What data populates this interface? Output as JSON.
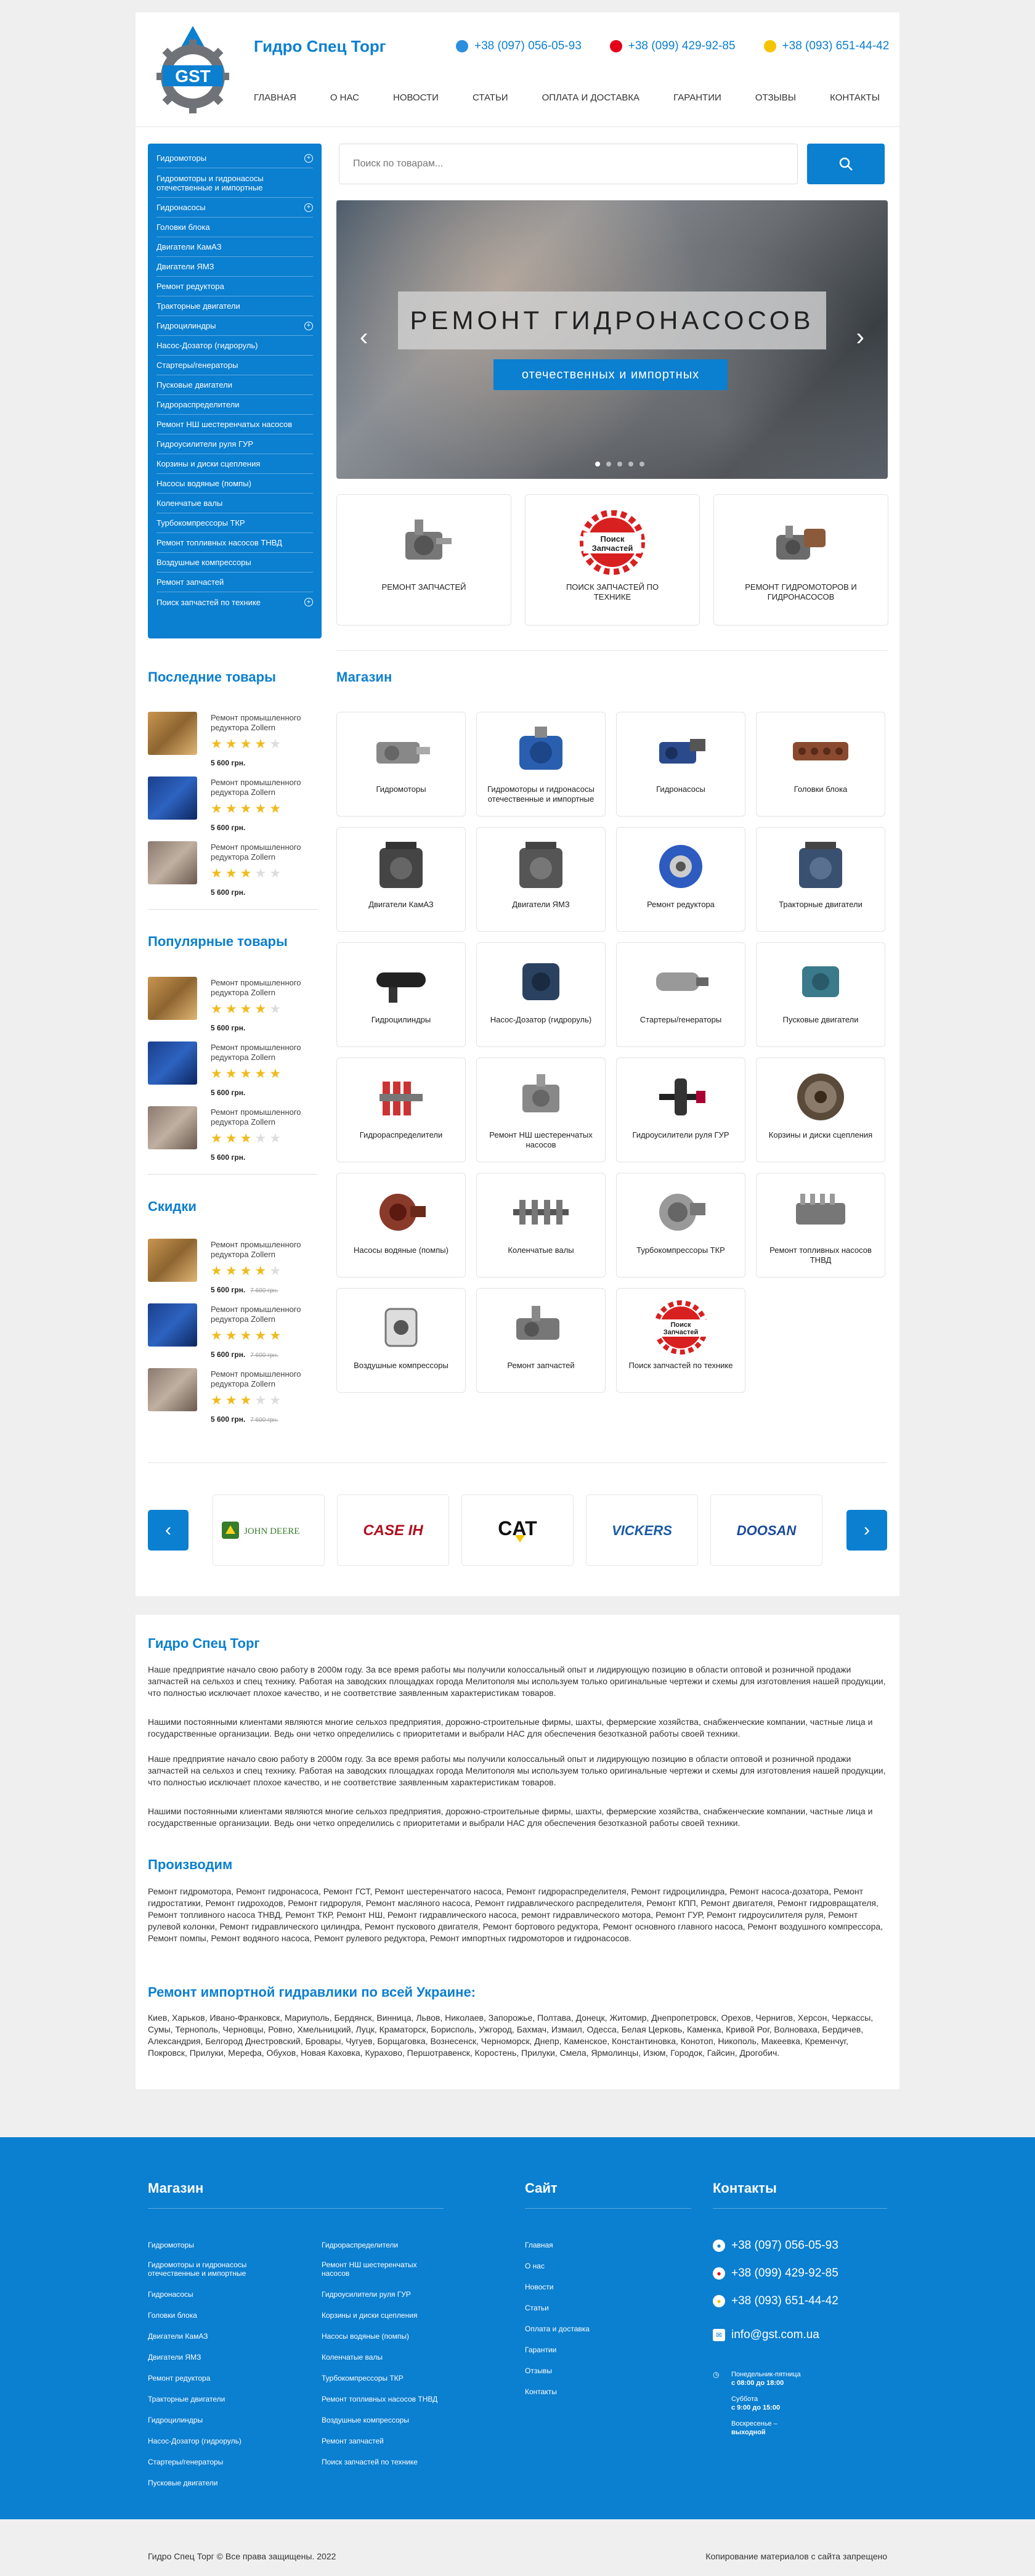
{
  "brand": {
    "name": "Гидро Спец Торг",
    "logo_text": "GST"
  },
  "phones": [
    "+38 (097) 056-05-93",
    "+38 (099) 429-92-85",
    "+38 (093) 651-44-42"
  ],
  "nav": [
    "Главная",
    "О нас",
    "Новости",
    "Статьи",
    "Оплата и доставка",
    "Гарантии",
    "Отзывы",
    "Контакты"
  ],
  "menu": [
    {
      "label": "Гидромоторы",
      "plus": true
    },
    {
      "label": "Гидромоторы и гидронасосы отечественные и импортные"
    },
    {
      "label": "Гидронасосы",
      "plus": true
    },
    {
      "label": "Головки блока"
    },
    {
      "label": "Двигатели КамАЗ"
    },
    {
      "label": "Двигатели ЯМЗ"
    },
    {
      "label": "Ремонт редуктора"
    },
    {
      "label": "Тракторные двигатели"
    },
    {
      "label": "Гидроцилиндры",
      "plus": true
    },
    {
      "label": "Насос-Дозатор (гидроруль)"
    },
    {
      "label": "Стартеры/генераторы"
    },
    {
      "label": "Пусковые двигатели"
    },
    {
      "label": "Гидрораспределители"
    },
    {
      "label": "Ремонт НШ шестеренчатых насосов"
    },
    {
      "label": "Гидроусилители руля ГУР"
    },
    {
      "label": "Корзины и диски сцепления"
    },
    {
      "label": "Насосы водяные (помпы)"
    },
    {
      "label": "Коленчатые валы"
    },
    {
      "label": "Турбокомпрессоры ТКР"
    },
    {
      "label": "Ремонт топливных насосов ТНВД"
    },
    {
      "label": "Воздушные компрессоры"
    },
    {
      "label": "Ремонт запчастей"
    },
    {
      "label": "Поиск запчастей по технике",
      "plus": true
    }
  ],
  "search": {
    "placeholder": "Поиск по товарам..."
  },
  "slider": {
    "title": "Ремонт гидронасосов",
    "subtitle": "отечественных и импортных"
  },
  "features": [
    {
      "label": "Ремонт запчастей"
    },
    {
      "label": "Поиск запчастей по технике",
      "stamp": "Поиск Запчастей"
    },
    {
      "label": "Ремонт гидромоторов и гидронасосов"
    }
  ],
  "widgets": {
    "latest": {
      "title": "Последние товары",
      "items": [
        {
          "name": "Ремонт промышленного редуктора Zollern",
          "stars": 4,
          "price": "5 600 грн."
        },
        {
          "name": "Ремонт промышленного редуктора Zollern",
          "stars": 5,
          "price": "5 600 грн."
        },
        {
          "name": "Ремонт промышленного редуктора Zollern",
          "stars": 3,
          "price": "5 600 грн."
        }
      ]
    },
    "popular": {
      "title": "Популярные товары",
      "items": [
        {
          "name": "Ремонт промышленного редуктора Zollern",
          "stars": 4,
          "price": "5 600 грн."
        },
        {
          "name": "Ремонт промышленного редуктора Zollern",
          "stars": 5,
          "price": "5 600 грн."
        },
        {
          "name": "Ремонт промышленного редуктора Zollern",
          "stars": 3,
          "price": "5 600 грн."
        }
      ]
    },
    "sale": {
      "title": "Скидки",
      "items": [
        {
          "name": "Ремонт промышленного редуктора Zollern",
          "stars": 4,
          "price": "5 600 грн.",
          "old": "7 600 грн."
        },
        {
          "name": "Ремонт промышленного редуктора Zollern",
          "stars": 5,
          "price": "5 600 грн.",
          "old": "7 600 грн."
        },
        {
          "name": "Ремонт промышленного редуктора Zollern",
          "stars": 3,
          "price": "5 600 грн.",
          "old": "7 600 грн."
        }
      ]
    }
  },
  "shop": {
    "title": "Магазин",
    "items": [
      "Гидромоторы",
      "Гидромоторы и гидронасосы отечественные и импортные",
      "Гидронасосы",
      "Головки блока",
      "Двигатели КамАЗ",
      "Двигатели ЯМЗ",
      "Ремонт редуктора",
      "Тракторные двигатели",
      "Гидроцилиндры",
      "Насос-Дозатор (гидроруль)",
      "Стартеры/генераторы",
      "Пусковые двигатели",
      "Гидрораспределители",
      "Ремонт НШ шестеренчатых насосов",
      "Гидроусилители руля ГУР",
      "Корзины и диски сцепления",
      "Насосы водяные (помпы)",
      "Коленчатые валы",
      "Турбокомпрессоры ТКР",
      "Ремонт топливных насосов ТНВД",
      "Воздушные компрессоры",
      "Ремонт запчастей",
      "Поиск запчастей по технике"
    ]
  },
  "brands": [
    "JOHN DEERE",
    "CASE IH",
    "CAT",
    "VICKERS",
    "DOOSAN"
  ],
  "about": {
    "title": "Гидро Спец Торг",
    "paras": [
      "Наше предприятие начало свою работу в 2000м году. За все время работы мы получили колоссальный опыт и лидирующую позицию в области оптовой и розничной продажи запчастей на сельхоз и спец технику. Работая на заводских площадках города Мелитополя мы используем только оригинальные чертежи и схемы для изготовления нашей продукции, что полностью исключает плохое качество, и не соответствие заявленным характеристикам товаров.",
      "Нашими постоянными клиентами являются многие сельхоз предприятия, дорожно-строительные фирмы, шахты, фермерские хозяйства, снабженческие компании, частные лица и государственные организации. Ведь они четко определились с приоритетами и выбрали НАС для обеспечения безотказной работы своей техники.",
      "Наше предприятие начало свою работу в 2000м году. За все время работы мы получили колоссальный опыт и лидирующую позицию в области оптовой и розничной продажи запчастей на сельхоз и спец технику. Работая на заводских площадках города Мелитополя мы используем только оригинальные чертежи и схемы для изготовления нашей продукции, что полностью исключает плохое качество, и не соответствие заявленным характеристикам товаров.",
      "Нашими постоянными клиентами являются многие сельхоз предприятия, дорожно-строительные фирмы, шахты, фермерские хозяйства, снабженческие компании, частные лица и государственные организации. Ведь они четко определились с приоритетами и выбрали НАС для обеспечения безотказной работы своей техники."
    ],
    "produce_title": "Производим",
    "produce_text": "Ремонт гидромотора, Ремонт гидронасоса, Ремонт ГСТ, Ремонт шестеренчатого насоса, Ремонт гидрораспределителя, Ремонт гидроцилиндра, Ремонт насоса-дозатора, Ремонт гидростатики, Ремонт гидроходов, Ремонт гидроруля, Ремонт масляного насоса, Ремонт гидравлического распределителя, Ремонт КПП, Ремонт двигателя, Ремонт гидровращателя, Ремонт топливного насоса ТНВД, Ремонт ТКР, Ремонт НШ, Ремонт гидравлического насоса, ремонт гидравлического мотора, Ремонт ГУР, Ремонт гидроусилителя руля, Ремонт рулевой колонки, Ремонт гидравлического цилиндра, Ремонт пускового двигателя, Ремонт бортового редуктора, Ремонт основного главного насоса, Ремонт воздушного компрессора, Ремонт помпы, Ремонт водяного насоса, Ремонт рулевого редуктора, Ремонт импортных гидромоторов и гидронасосов.",
    "ukraine_title": "Ремонт импортной гидравлики по всей Украине:",
    "ukraine_text": "Киев, Харьков, Ивано-Франковск, Мариуполь, Бердянск, Винница, Львов, Николаев, Запорожье, Полтава, Донецк, Житомир, Днепропетровск, Орехов, Чернигов, Херсон, Черкассы, Сумы, Тернополь, Черновцы, Ровно, Хмельницкий, Луцк, Краматорск, Борисполь, Ужгород, Бахмач, Измаил, Одесса, Белая Церковь, Каменка, Кривой Рог, Волноваха, Бердичев, Александрия, Белгород Днестровский, Бровары, Чугуев, Борщаговка, Вознесенск, Черноморск, Днепр, Каменское, Константиновка, Конотоп, Никополь, Макеевка, Кременчуг, Покровск, Прилуки, Мерефа, Обухов, Новая Каховка, Кураховo, Першотравенск, Коростень, Прилуки, Смела, Ярмолинцы, Изюм, Городок, Гайсин, Дрогобич."
  },
  "footer": {
    "shop_title": "Магазин",
    "shop_col1": [
      "Гидромоторы",
      "Гидромоторы и гидронасосы отечественные и импортные",
      "Гидронасосы",
      "Головки блока",
      "Двигатели КамАЗ",
      "Двигатели ЯМЗ",
      "Ремонт редуктора",
      "Тракторные двигатели",
      "Гидроцилиндры",
      "Насос-Дозатор (гидроруль)",
      "Стартеры/генераторы",
      "Пусковые двигатели"
    ],
    "shop_col2": [
      "Гидрораспределители",
      "Ремонт НШ шестеренчатых насосов",
      "Гидроусилители руля ГУР",
      "Корзины и диски сцепления",
      "Насосы водяные (помпы)",
      "Коленчатые валы",
      "Турбокомпрессоры ТКР",
      "Ремонт топливных насосов ТНВД",
      "Воздушные компрессоры",
      "Ремонт запчастей",
      "Поиск запчастей по технике"
    ],
    "site_title": "Сайт",
    "site_links": [
      "Главная",
      "О нас",
      "Новости",
      "Статьи",
      "Оплата и доставка",
      "Гарантии",
      "Отзывы",
      "Контакты"
    ],
    "contacts_title": "Контакты",
    "email": "info@gst.com.ua",
    "hours": [
      "Понедельник-пятница",
      "с 08:00 до 18:00",
      "Суббота",
      "с 9:00 до 15:00",
      "Воскресенье –",
      "выходной"
    ],
    "copyright": "Гидро Спец Торг © Все права защищены. 2022",
    "copy_notice": "Копирование материалов с сайта запрещено"
  },
  "colors": {
    "accent": "#0b7fd0",
    "star": "#f0bb1e"
  }
}
